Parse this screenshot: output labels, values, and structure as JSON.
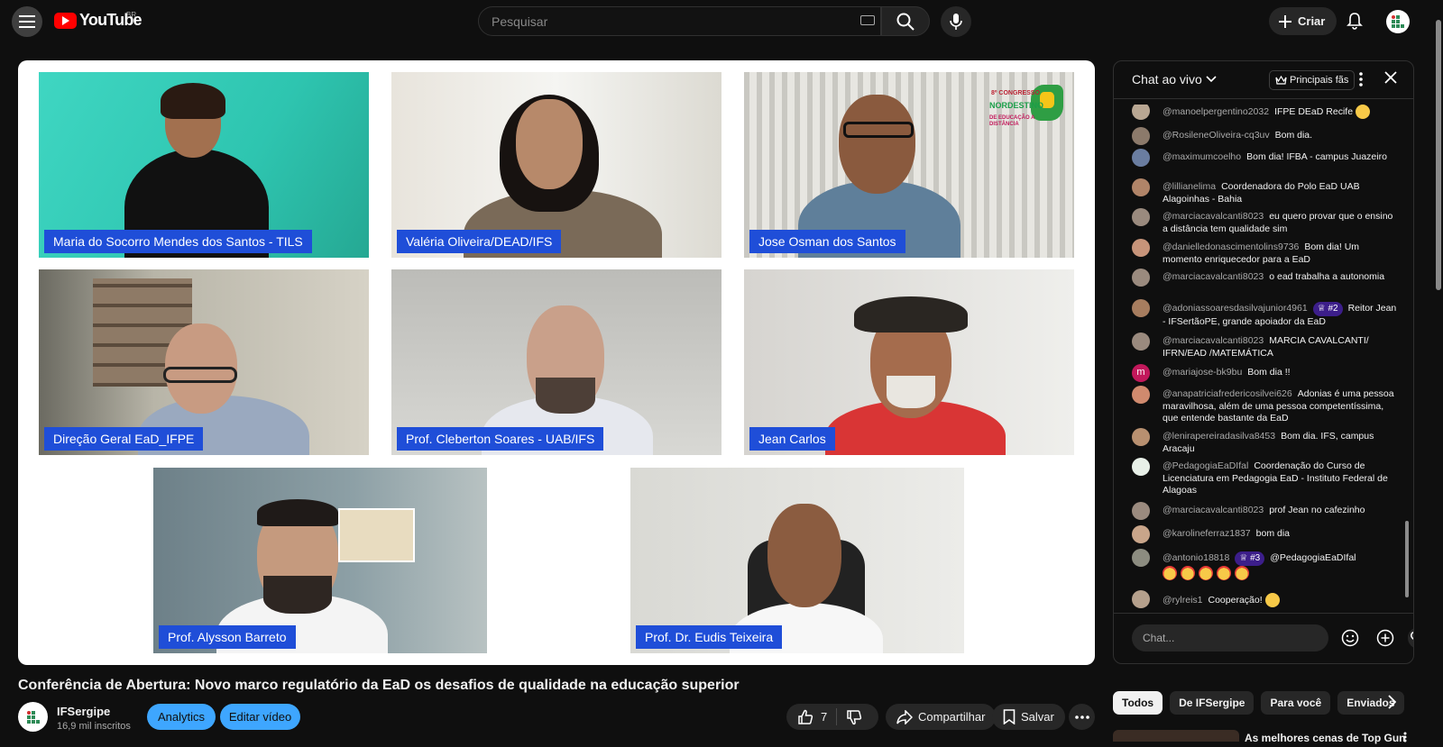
{
  "header": {
    "logo_text": "YouTube",
    "country_code": "BR",
    "search_placeholder": "Pesquisar",
    "create_label": "Criar"
  },
  "video": {
    "participants": [
      "Maria do Socorro Mendes dos Santos - TILS",
      "Valéria Oliveira/DEAD/IFS",
      "Jose Osman dos Santos",
      "Direção Geral EaD_IFPE",
      "Prof. Cleberton Soares - UAB/IFS",
      "Jean Carlos",
      "Prof. Alysson Barreto",
      "Prof. Dr. Eudis Teixeira"
    ],
    "congress_logo": {
      "line1": "8º CONGRESSO",
      "line2": "NORDESTINO",
      "line3": "DE EDUCAÇÃO A DISTÂNCIA"
    }
  },
  "meta": {
    "title": "Conferência de Abertura: Novo marco regulatório da EaD os desafios de qualidade na educação superior",
    "channel_name": "IFSergipe",
    "subscribers": "16,9 mil inscritos",
    "analytics_label": "Analytics",
    "edit_label": "Editar vídeo",
    "like_count": "7",
    "share_label": "Compartilhar",
    "save_label": "Salvar"
  },
  "chat": {
    "title": "Chat ao vivo",
    "top_fans_label": "Principais fãs",
    "input_placeholder": "Chat...",
    "messages": [
      {
        "author": "@manoelpergentino2032",
        "text": "IFPE DEaD Recife"
      },
      {
        "author": "@RosileneOliveira-cq3uv",
        "text": "Bom dia."
      },
      {
        "author": "@maximumcoelho",
        "text": "Bom dia! IFBA - campus Juazeiro"
      },
      {
        "author": "@lillianelima",
        "text": "Coordenadora do Polo EaD UAB Alagoinhas - Bahia"
      },
      {
        "author": "@marciacavalcanti8023",
        "text": "eu quero provar que o ensino a distância tem qualidade sim"
      },
      {
        "author": "@danielledonascimentolins9736",
        "text": "Bom dia! Um momento enriquecedor para a EaD"
      },
      {
        "author": "@marciacavalcanti8023",
        "text": "o ead trabalha a autonomia"
      },
      {
        "author": "@adoniassoaresdasilvajunior4961",
        "badge": "#2",
        "text": "Reitor Jean - IFSertãoPE, grande apoiador da EaD"
      },
      {
        "author": "@marciacavalcanti8023",
        "text": "MARCIA CAVALCANTI/ IFRN/EAD /MATEMÁTICA"
      },
      {
        "author": "@mariajose-bk9bu",
        "avatar_letter": "m",
        "text": "Bom dia !!"
      },
      {
        "author": "@anapatriciafredericosilvei626",
        "text": "Adonias é uma pessoa maravilhosa, além de uma pessoa competentíssima, que entende bastante da EaD"
      },
      {
        "author": "@lenirapereiradasilva8453",
        "text": "Bom dia. IFS, campus Aracaju"
      },
      {
        "author": "@PedagogiaEaDIfal",
        "text": "Coordenação do Curso de Licenciatura em Pedagogia EaD - Instituto Federal de Alagoas"
      },
      {
        "author": "@marciacavalcanti8023",
        "text": "prof Jean no cafezinho"
      },
      {
        "author": "@karolineferraz1837",
        "text": "bom dia"
      },
      {
        "author": "@antonio18818",
        "badge": "#3",
        "text": "@PedagogiaEaDIfal"
      },
      {
        "author": "@rylreis1",
        "text": "Cooperação!"
      }
    ]
  },
  "recommendations": {
    "chips": [
      "Todos",
      "De IFSergipe",
      "Para você",
      "Enviados"
    ],
    "first_title": "As melhores cenas de Top Gun"
  }
}
